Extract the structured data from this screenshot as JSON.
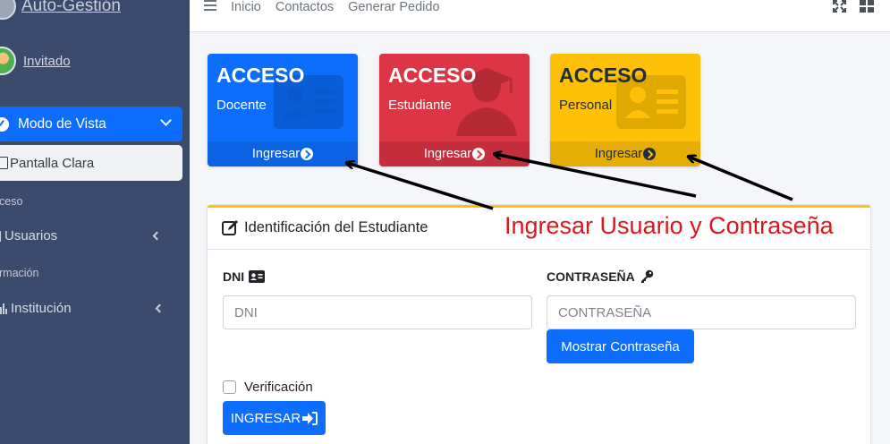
{
  "brand": {
    "name": "Auto-Gestión"
  },
  "user": {
    "name": "Invitado"
  },
  "sidebar": {
    "active": {
      "label": "Modo de Vista"
    },
    "sub": {
      "label": "Pantalla Clara"
    },
    "items": [
      {
        "type": "header",
        "label": "ceso"
      },
      {
        "type": "item",
        "label": "Usuarios"
      },
      {
        "type": "header",
        "label": "rmación"
      },
      {
        "type": "item",
        "label": "Institución"
      }
    ]
  },
  "topbar": {
    "links": [
      "Inicio",
      "Contactos",
      "Generar Pedido"
    ]
  },
  "boxes": [
    {
      "title": "ACCESO",
      "subtitle": "Docente",
      "footer": "Ingresar",
      "color": "#0d6efd",
      "icon": "id-card-icon"
    },
    {
      "title": "ACCESO",
      "subtitle": "Estudiante",
      "footer": "Ingresar",
      "color": "#dc3545",
      "icon": "graduate-icon"
    },
    {
      "title": "ACCESO",
      "subtitle": "Personal",
      "footer": "Ingresar",
      "color": "#ffc107",
      "icon": "id-badge-icon"
    }
  ],
  "card": {
    "title": "Identificación del Estudiante",
    "accent": "#ffc107",
    "annotation": "Ingresar Usuario y Contraseña",
    "annotation_color": "#e0141b",
    "dni_label": "DNI",
    "dni_placeholder": "DNI",
    "password_label": "CONTRASEÑA",
    "password_placeholder": "CONTRASEÑA",
    "show_password": "Mostrar Contraseña",
    "verify_label": "Verificación",
    "submit": "INGRESAR"
  }
}
